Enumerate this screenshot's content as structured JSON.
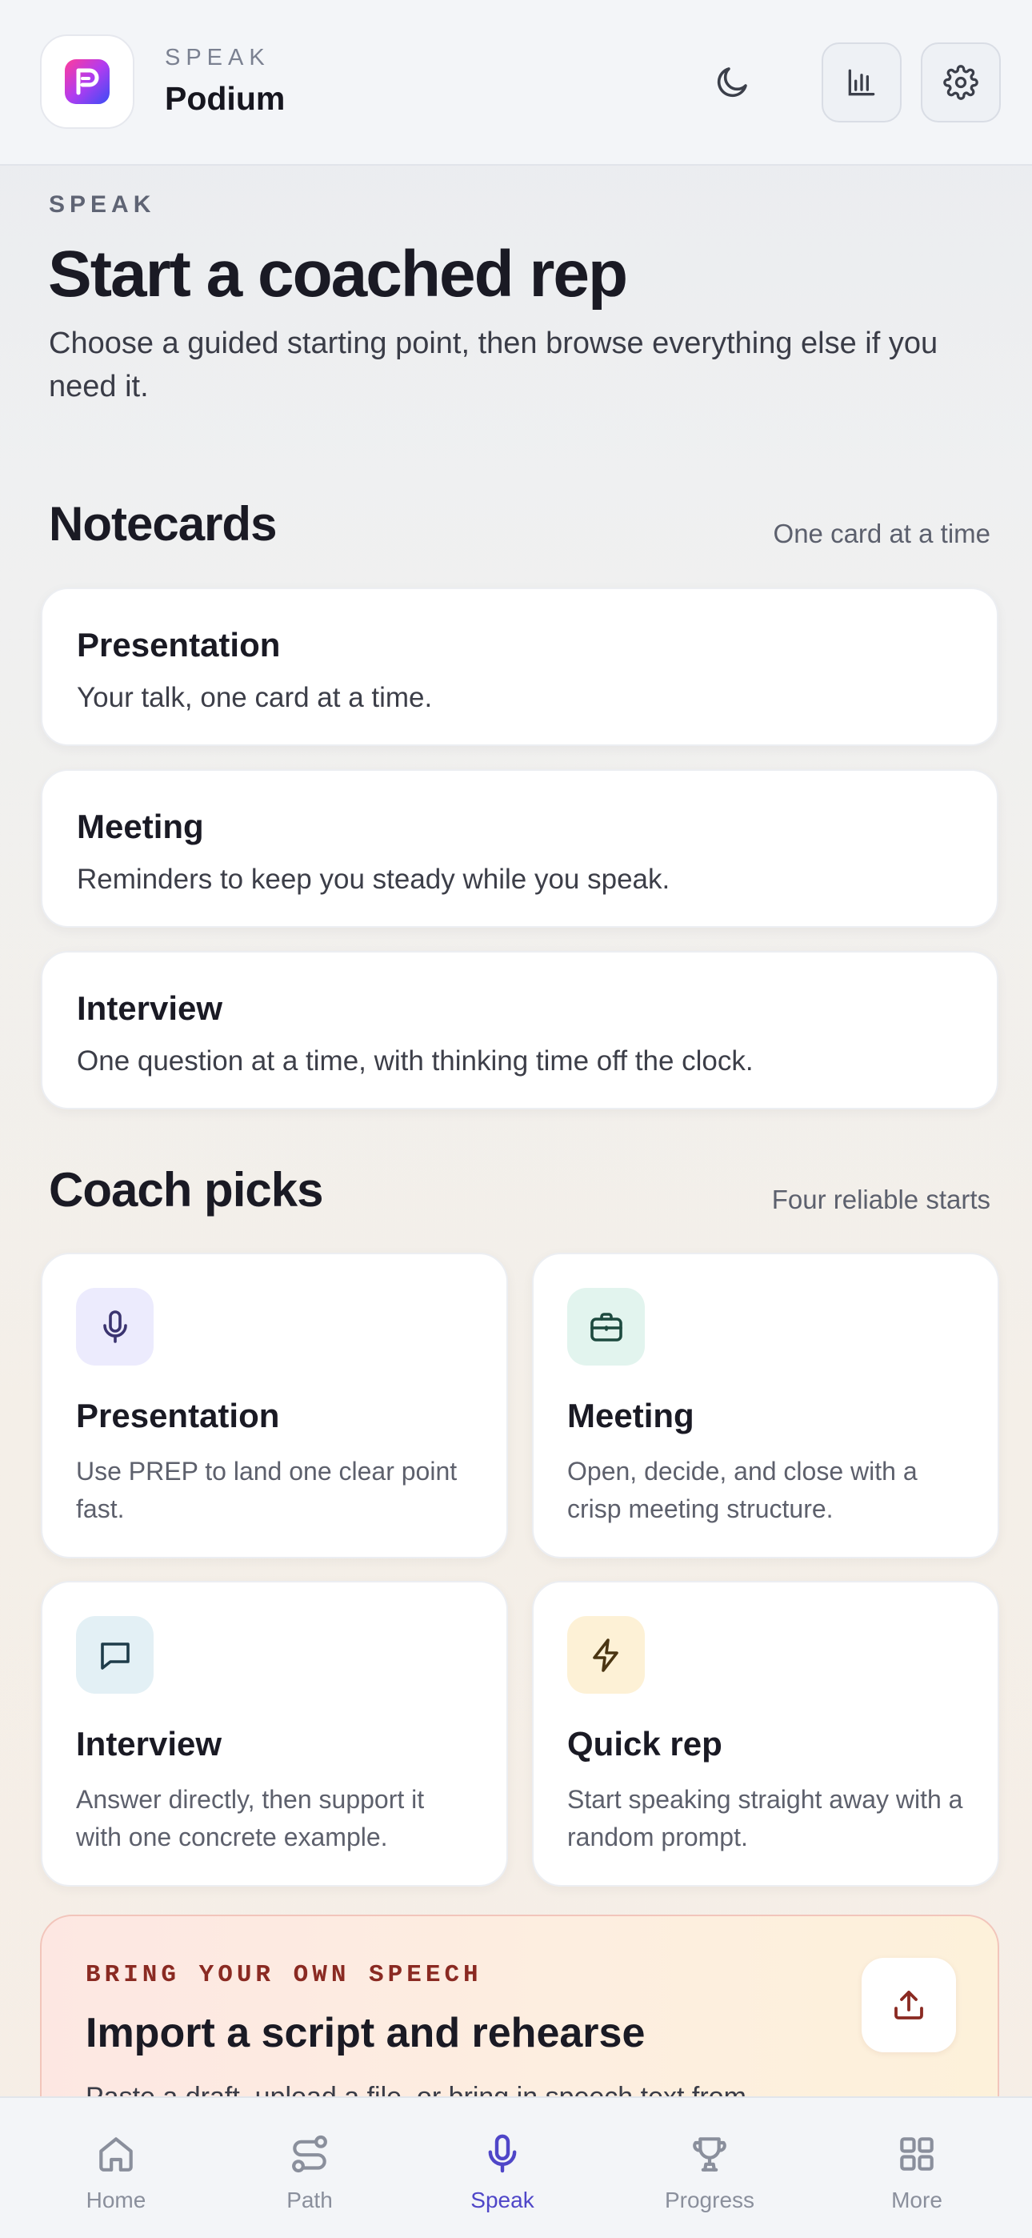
{
  "header": {
    "subtitle": "SPEAK",
    "title": "Podium"
  },
  "hero": {
    "eyebrow": "SPEAK",
    "title": "Start a coached rep",
    "description": "Choose a guided starting point, then browse everything else if you need it."
  },
  "notecards": {
    "title": "Notecards",
    "note": "One card at a time",
    "items": [
      {
        "title": "Presentation",
        "desc": "Your talk, one card at a time."
      },
      {
        "title": "Meeting",
        "desc": "Reminders to keep you steady while you speak."
      },
      {
        "title": "Interview",
        "desc": "One question at a time, with thinking time off the clock."
      }
    ]
  },
  "coach_picks": {
    "title": "Coach picks",
    "note": "Four reliable starts",
    "items": [
      {
        "title": "Presentation",
        "desc": "Use PREP to land one clear point fast.",
        "icon": "microphone-icon",
        "color": "#ecebfd"
      },
      {
        "title": "Meeting",
        "desc": "Open, decide, and close with a crisp meeting structure.",
        "icon": "briefcase-icon",
        "color": "#e2f4ee"
      },
      {
        "title": "Interview",
        "desc": "Answer directly, then support it with one concrete example.",
        "icon": "chat-bubble-icon",
        "color": "#e3f0f5"
      },
      {
        "title": "Quick rep",
        "desc": "Start speaking straight away with a random prompt.",
        "icon": "lightning-icon",
        "color": "#fdf1d6"
      }
    ]
  },
  "import": {
    "eyebrow": "BRING YOUR OWN SPEECH",
    "title": "Import a script and rehearse",
    "description": "Paste a draft, upload a file, or bring in speech text from"
  },
  "nav": {
    "items": [
      {
        "label": "Home"
      },
      {
        "label": "Path"
      },
      {
        "label": "Speak"
      },
      {
        "label": "Progress"
      },
      {
        "label": "More"
      }
    ],
    "active": "Speak"
  },
  "colors": {
    "accent": "#4f46c8",
    "import_accent": "#8a2a22"
  }
}
